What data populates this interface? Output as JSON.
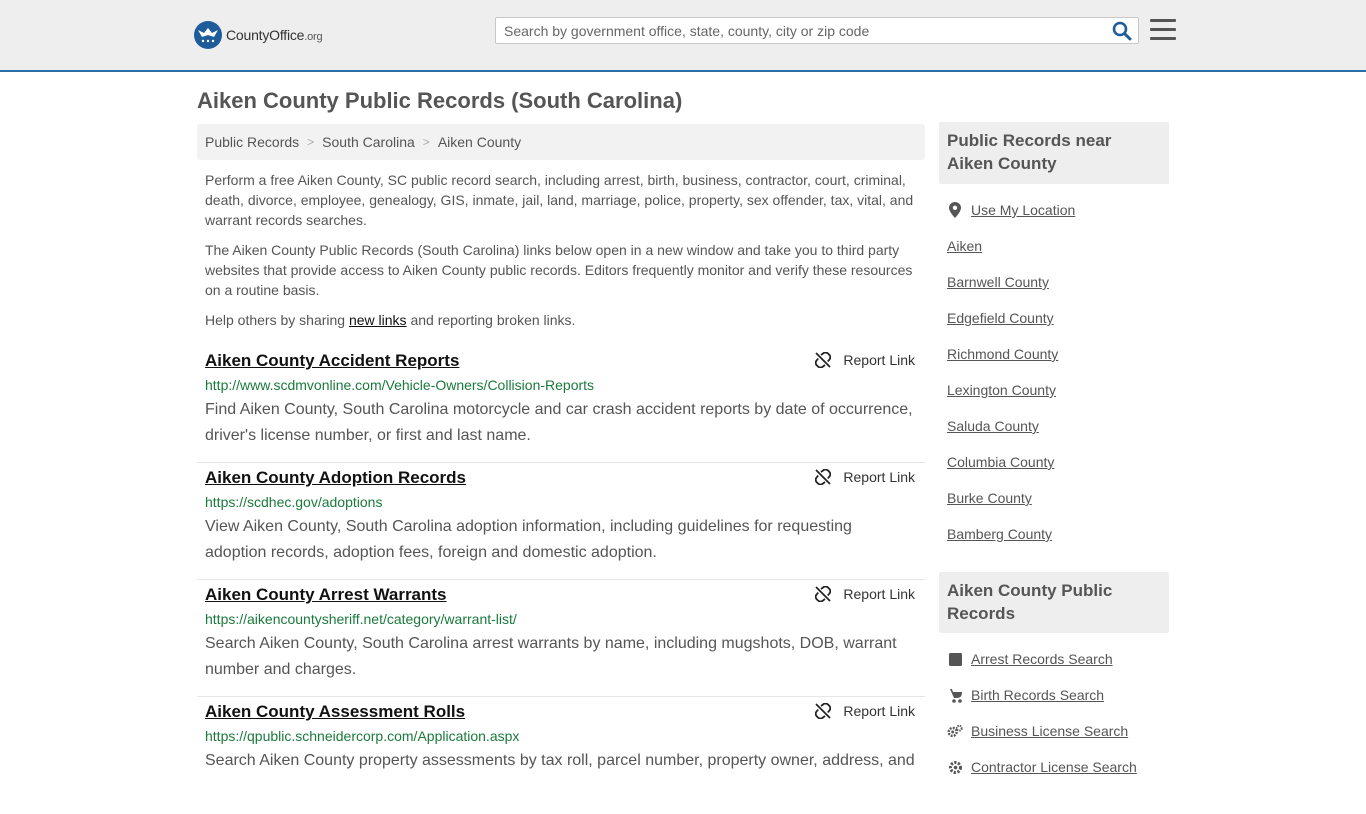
{
  "header": {
    "logo_main": "CountyOffice",
    "logo_suffix": ".org",
    "search_placeholder": "Search by government office, state, county, city or zip code"
  },
  "page": {
    "title": "Aiken County Public Records (South Carolina)"
  },
  "breadcrumb": [
    "Public Records",
    "South Carolina",
    "Aiken County"
  ],
  "intro": {
    "p1": "Perform a free Aiken County, SC public record search, including arrest, birth, business, contractor, court, criminal, death, divorce, employee, genealogy, GIS, inmate, jail, land, marriage, police, property, sex offender, tax, vital, and warrant records searches.",
    "p2": "The Aiken County Public Records (South Carolina) links below open in a new window and take you to third party websites that provide access to Aiken County public records. Editors frequently monitor and verify these resources on a routine basis.",
    "p3_before": "Help others by sharing ",
    "p3_link": "new links",
    "p3_after": " and reporting broken links."
  },
  "report_label": "Report Link",
  "records": [
    {
      "title": "Aiken County Accident Reports",
      "url": "http://www.scdmvonline.com/Vehicle-Owners/Collision-Reports",
      "desc": "Find Aiken County, South Carolina motorcycle and car crash accident reports by date of occurrence, driver's license number, or first and last name."
    },
    {
      "title": "Aiken County Adoption Records",
      "url": "https://scdhec.gov/adoptions",
      "desc": "View Aiken County, South Carolina adoption information, including guidelines for requesting adoption records, adoption fees, foreign and domestic adoption."
    },
    {
      "title": "Aiken County Arrest Warrants",
      "url": "https://aikencountysheriff.net/category/warrant-list/",
      "desc": "Search Aiken County, South Carolina arrest warrants by name, including mugshots, DOB, warrant number and charges."
    },
    {
      "title": "Aiken County Assessment Rolls",
      "url": "https://qpublic.schneidercorp.com/Application.aspx",
      "desc": "Search Aiken County property assessments by tax roll, parcel number, property owner, address, and"
    }
  ],
  "sidebar": {
    "near_title": "Public Records near Aiken County",
    "use_location": "Use My Location",
    "near_items": [
      "Aiken",
      "Barnwell County",
      "Edgefield County",
      "Richmond County",
      "Lexington County",
      "Saluda County",
      "Columbia County",
      "Burke County",
      "Bamberg County"
    ],
    "records_title": "Aiken County Public Records",
    "record_items": [
      {
        "label": "Arrest Records Search",
        "icon": "square-icon"
      },
      {
        "label": "Birth Records Search",
        "icon": "baby-carriage-icon"
      },
      {
        "label": "Business License Search",
        "icon": "gears-icon"
      },
      {
        "label": "Contractor License Search",
        "icon": "gear-icon"
      }
    ]
  }
}
